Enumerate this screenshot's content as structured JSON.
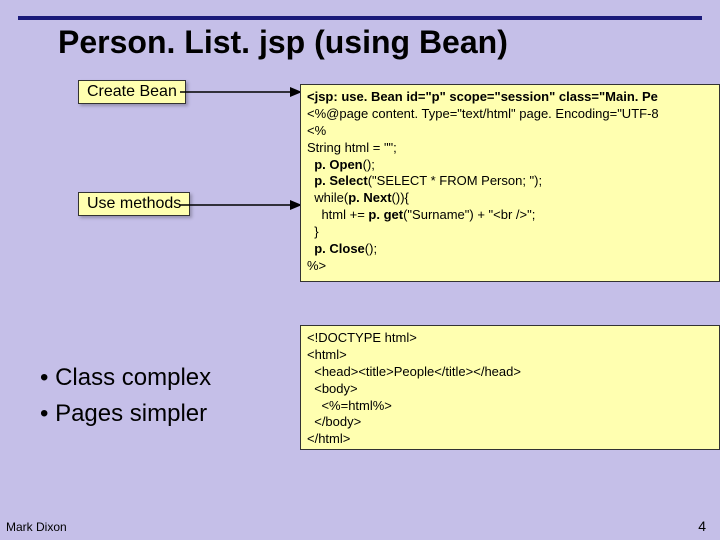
{
  "title": "Person. List. jsp (using Bean)",
  "labels": {
    "create": "Create Bean",
    "use": "Use methods"
  },
  "code1": {
    "l1a": "<jsp: use. Bean id=\"p\" scope=\"session\" class=\"Main. Pe",
    "l2": "<%@page content. Type=\"text/html\" page. Encoding=\"UTF-8",
    "l3": "<%",
    "l4": "String html = \"\";",
    "l5a": "  p. Open",
    "l5b": "();",
    "l6a": "  p. Select",
    "l6b": "(\"SELECT * FROM Person; \");",
    "l7a": "  while(",
    "l7b": "p. Next",
    "l7c": "()){",
    "l8a": "    html += ",
    "l8b": "p. get",
    "l8c": "(\"Surname\") + \"<br />\";",
    "l9": "  }",
    "l10a": "  p. Close",
    "l10b": "();",
    "l11": "%>"
  },
  "code2": {
    "l1": "<!DOCTYPE html>",
    "l2": "<html>",
    "l3": "  <head><title>People</title></head>",
    "l4": "  <body>",
    "l5": "    <%=html%>",
    "l6": "  </body>",
    "l7": "</html>"
  },
  "bullets": {
    "b1": "• Class complex",
    "b2": "• Pages simpler"
  },
  "footer": {
    "left": "Mark Dixon",
    "right": "4"
  }
}
